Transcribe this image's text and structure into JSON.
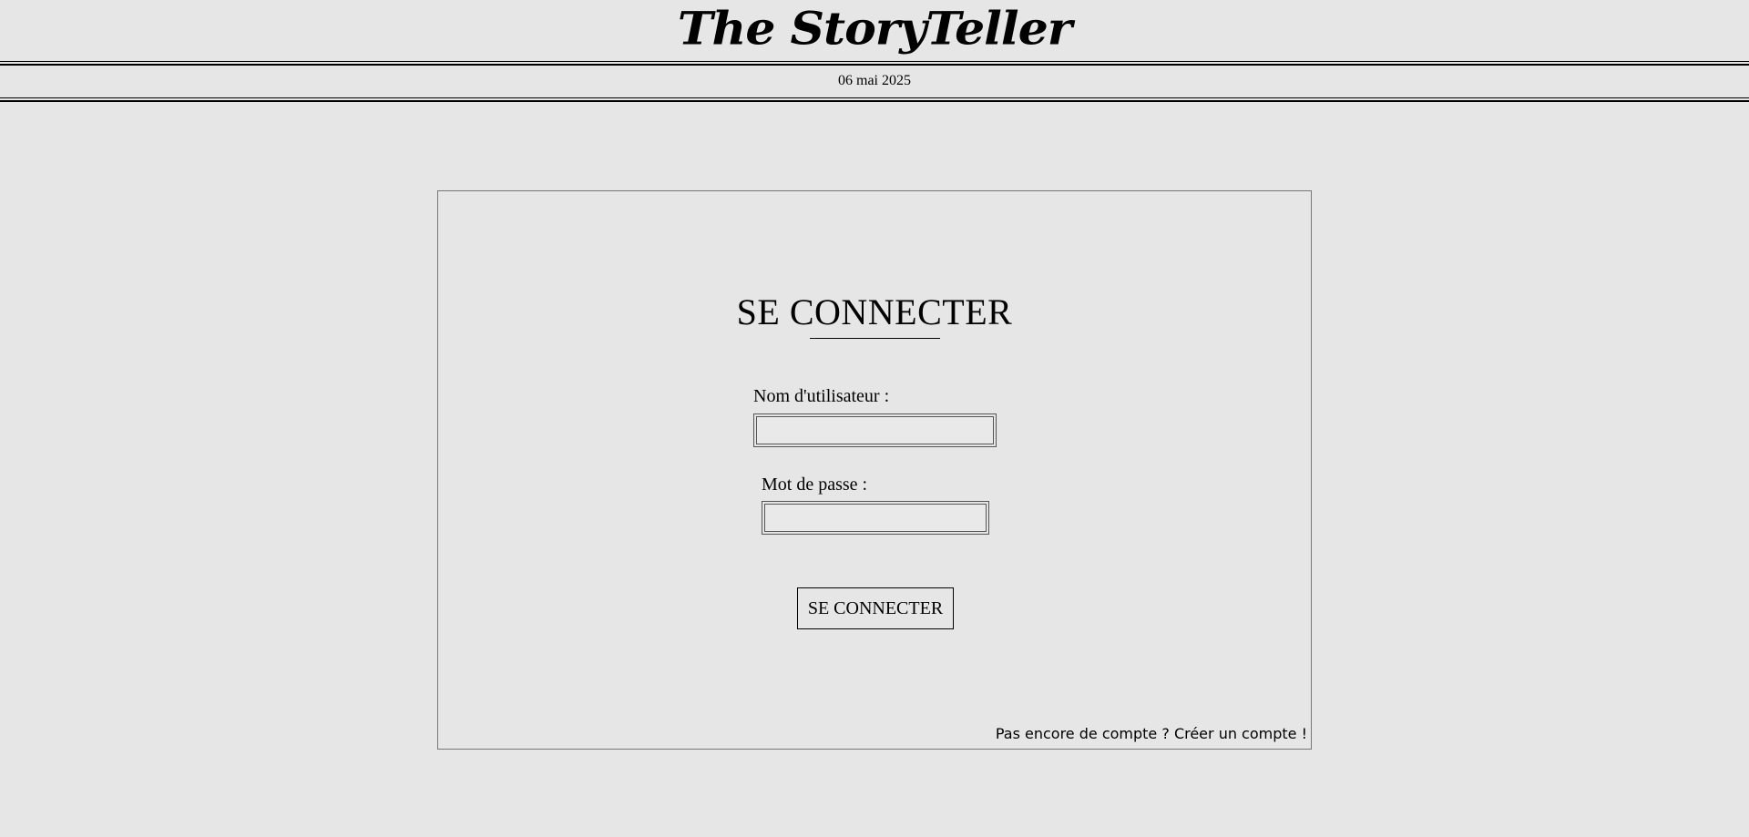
{
  "header": {
    "site_title": "The StoryTeller",
    "date": "06 mai 2025"
  },
  "login": {
    "title": "SE CONNECTER",
    "username_label": "Nom d'utilisateur :",
    "username_value": "",
    "password_label": "Mot de passe :",
    "password_value": "",
    "submit_label": "SE CONNECTER",
    "signup_prompt": "Pas encore de compte ?",
    "signup_link": "Créer un compte !"
  }
}
